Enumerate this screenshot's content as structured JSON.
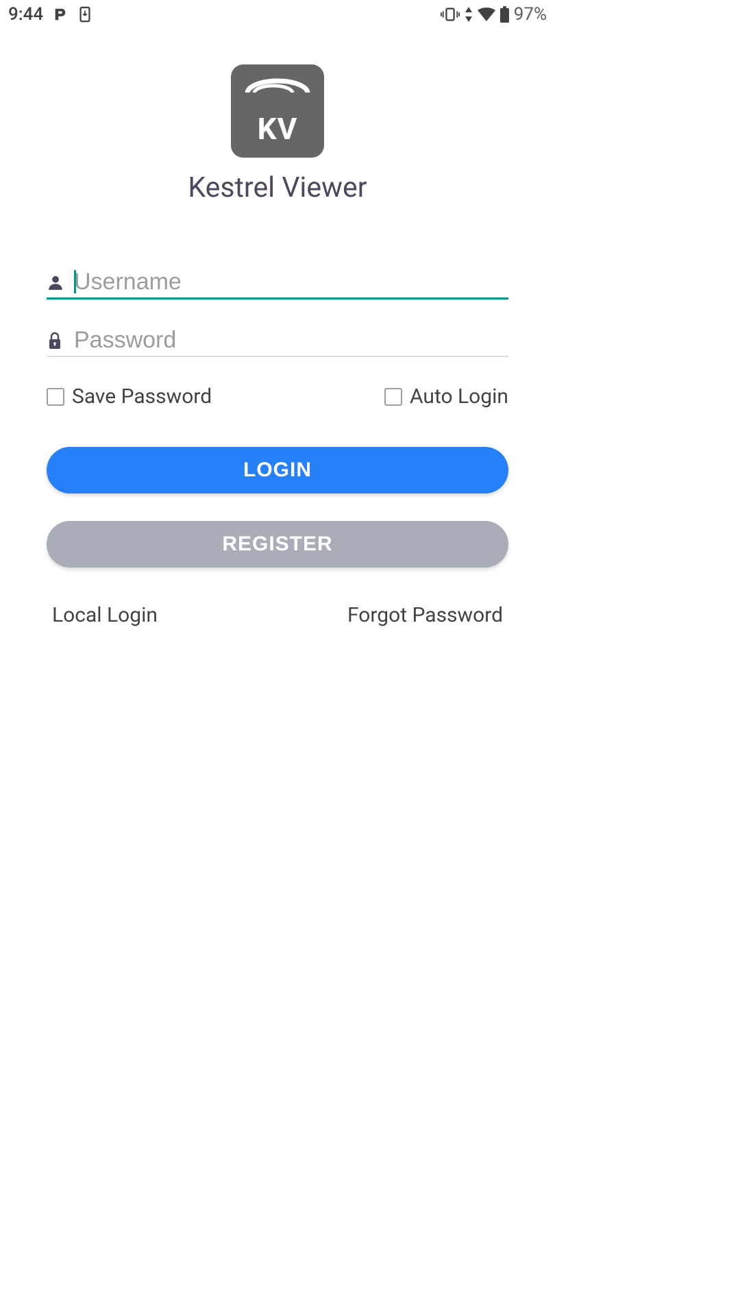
{
  "status_bar": {
    "time": "9:44",
    "battery_pct": "97%"
  },
  "logo": {
    "letters": "KV"
  },
  "app_title": "Kestrel Viewer",
  "form": {
    "username_placeholder": "Username",
    "password_placeholder": "Password",
    "save_password_label": "Save Password",
    "auto_login_label": "Auto Login"
  },
  "buttons": {
    "login": "LOGIN",
    "register": "REGISTER"
  },
  "links": {
    "local_login": "Local Login",
    "forgot_password": "Forgot Password"
  }
}
